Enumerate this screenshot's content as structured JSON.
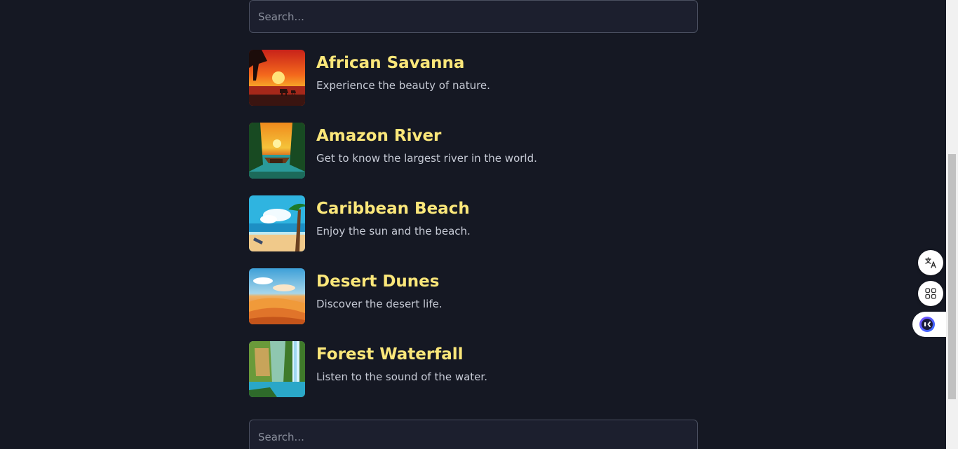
{
  "search": {
    "placeholder": "Search..."
  },
  "destinations": [
    {
      "title": "African Savanna",
      "description": "Experience the beauty of nature.",
      "image": "savanna-sunset-image"
    },
    {
      "title": "Amazon River",
      "description": "Get to know the largest river in the world.",
      "image": "amazon-river-image"
    },
    {
      "title": "Caribbean Beach",
      "description": "Enjoy the sun and the beach.",
      "image": "caribbean-beach-image"
    },
    {
      "title": "Desert Dunes",
      "description": "Discover the desert life.",
      "image": "desert-dunes-image"
    },
    {
      "title": "Forest Waterfall",
      "description": "Listen to the sound of the water.",
      "image": "forest-waterfall-image"
    }
  ],
  "floating_tools": {
    "translate_icon": "translate-icon",
    "apps_icon": "apps-grid-icon",
    "assistant_icon": "assistant-icon"
  },
  "colors": {
    "background": "#151823",
    "title": "#fbe77a",
    "description": "#c7cbd6",
    "input_bg": "#1c1f2e",
    "input_border": "#4a4f60"
  }
}
